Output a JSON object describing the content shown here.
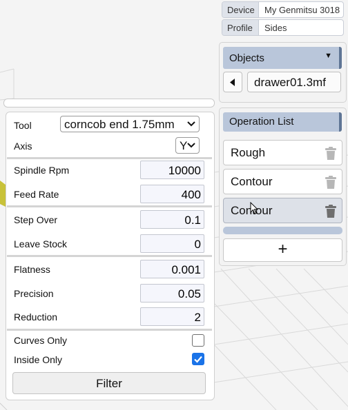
{
  "info": {
    "device_key": "Device",
    "device_value": "My Genmitsu 3018",
    "profile_key": "Profile",
    "profile_value": "Sides"
  },
  "objects": {
    "header": "Objects",
    "caret": "▼",
    "current": "drawer01.3mf",
    "prev_icon": "triangle-left-icon"
  },
  "operations": {
    "header": "Operation List",
    "items": [
      {
        "label": "Rough",
        "selected": false
      },
      {
        "label": "Contour",
        "selected": false
      },
      {
        "label": "Contour",
        "selected": true
      }
    ],
    "add_label": "+",
    "delete_icon": "trash-icon"
  },
  "params": {
    "tool_label": "Tool",
    "tool_value": "corncob end 1.75mm",
    "axis_label": "Axis",
    "axis_value": "Y",
    "spindle_label": "Spindle Rpm",
    "spindle_value": "10000",
    "feed_label": "Feed Rate",
    "feed_value": "400",
    "stepover_label": "Step Over",
    "stepover_value": "0.1",
    "leavestock_label": "Leave Stock",
    "leavestock_value": "0",
    "flatness_label": "Flatness",
    "flatness_value": "0.001",
    "precision_label": "Precision",
    "precision_value": "0.05",
    "reduction_label": "Reduction",
    "reduction_value": "2",
    "curves_label": "Curves Only",
    "curves_checked": false,
    "inside_label": "Inside Only",
    "inside_checked": true,
    "filter_label": "Filter"
  },
  "colors": {
    "accent": "#b9c6da",
    "accent_border": "#5f7595",
    "checkbox_on": "#1a73e8"
  }
}
